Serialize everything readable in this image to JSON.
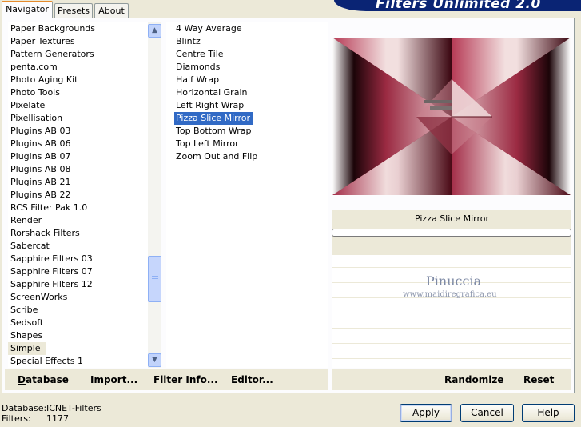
{
  "tabs": [
    "Navigator",
    "Presets",
    "About"
  ],
  "brand": "Filters Unlimited 2.0",
  "categories": [
    "Paper Backgrounds",
    "Paper Textures",
    "Pattern Generators",
    "penta.com",
    "Photo Aging Kit",
    "Photo Tools",
    "Pixelate",
    "Pixellisation",
    "Plugins AB 03",
    "Plugins AB 06",
    "Plugins AB 07",
    "Plugins AB 08",
    "Plugins AB 21",
    "Plugins AB 22",
    "RCS Filter Pak 1.0",
    "Render",
    "Rorshack Filters",
    "Sabercat",
    "Sapphire Filters 03",
    "Sapphire Filters 07",
    "Sapphire Filters 12",
    "ScreenWorks",
    "Scribe",
    "Sedsoft",
    "Shapes",
    "Simple",
    "Special Effects 1"
  ],
  "selected_category": "Simple",
  "filters": [
    "4 Way Average",
    "Blintz",
    "Centre Tile",
    "Diamonds",
    "Half Wrap",
    "Horizontal Grain",
    "Left Right Wrap",
    "Pizza Slice Mirror",
    "Top Bottom Wrap",
    "Top Left Mirror",
    "Zoom Out and Flip"
  ],
  "selected_filter": "Pizza Slice Mirror",
  "links": {
    "database": "Database",
    "import": "Import...",
    "filter_info": "Filter Info...",
    "editor": "Editor...",
    "randomize": "Randomize",
    "reset": "Reset"
  },
  "preview": {
    "filter_name": "Pizza Slice Mirror",
    "progress": 0,
    "watermark_title": "Pinuccia",
    "watermark_url": "www.maidiregrafica.eu"
  },
  "status": {
    "database_label": "Database:",
    "database_value": "ICNET-Filters",
    "filters_label": "Filters:",
    "filters_value": "1177"
  },
  "buttons": {
    "apply": "Apply",
    "cancel": "Cancel",
    "help": "Help"
  },
  "colors": {
    "selection": "#316ac5",
    "dialog_bg": "#ece9d8",
    "brand_bg": "#0a2474",
    "preview_crimson": "#9b2a42"
  }
}
